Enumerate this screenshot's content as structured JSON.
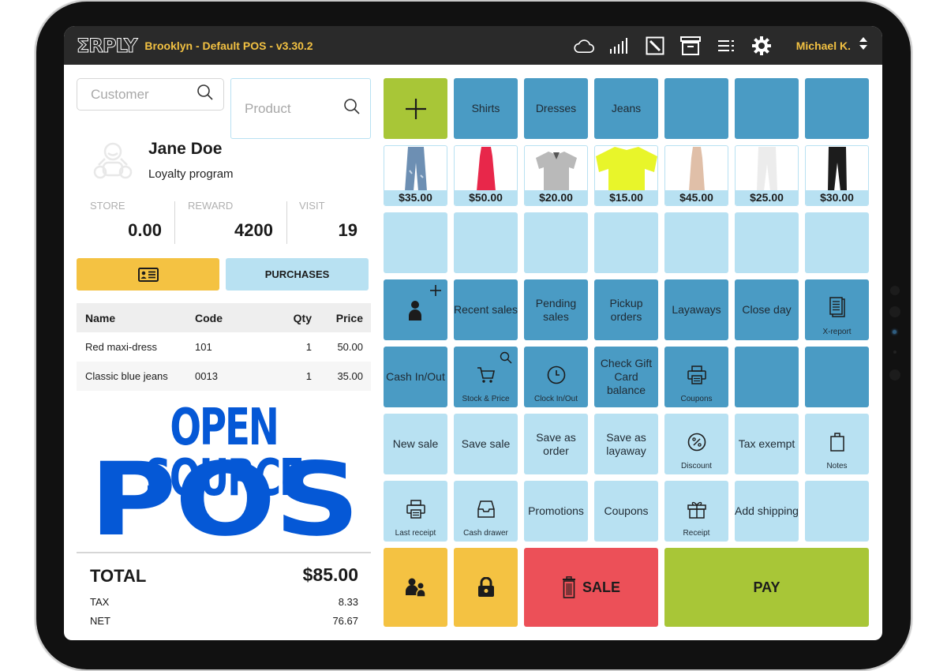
{
  "header": {
    "logo": "ΣRPLY",
    "title": "Brooklyn - Default POS - v3.30.2",
    "icons": [
      "cloud-icon",
      "signal-icon",
      "edit-icon",
      "archive-icon",
      "list-icon",
      "gear-icon"
    ],
    "user": "Michael K."
  },
  "search": {
    "customer_placeholder": "Customer",
    "product_placeholder": "Product"
  },
  "customer": {
    "name": "Jane Doe",
    "program": "Loyalty program"
  },
  "stats": [
    {
      "label": "STORE",
      "value": "0.00"
    },
    {
      "label": "REWARD",
      "value": "4200"
    },
    {
      "label": "VISIT",
      "value": "19"
    }
  ],
  "buttons": {
    "purchases": "PURCHASES"
  },
  "cart": {
    "headers": [
      "Name",
      "Code",
      "Qty",
      "Price"
    ],
    "rows": [
      {
        "name": "Red maxi-dress",
        "code": "101",
        "qty": "1",
        "price": "50.00"
      },
      {
        "name": "Classic blue jeans",
        "code": "0013",
        "qty": "1",
        "price": "35.00"
      }
    ]
  },
  "banner": {
    "line1": "OPEN SOURCE",
    "line2": "POS"
  },
  "totals": {
    "total_label": "TOTAL",
    "total_value": "$85.00",
    "tax_label": "TAX",
    "tax_value": "8.33",
    "net_label": "NET",
    "net_value": "76.67"
  },
  "categories": [
    "Shirts",
    "Dresses",
    "Jeans",
    "",
    "",
    ""
  ],
  "products": [
    {
      "name": "jeans",
      "price": "$35.00",
      "color": "#6d8fb3"
    },
    {
      "name": "red-dress",
      "price": "$50.00",
      "color": "#e8274a"
    },
    {
      "name": "grey-polo",
      "price": "$20.00",
      "color": "#b9b9b9"
    },
    {
      "name": "yellow-tshirt",
      "price": "$15.00",
      "color": "#e8f52a"
    },
    {
      "name": "beige-dress",
      "price": "$45.00",
      "color": "#e0bfa8"
    },
    {
      "name": "white-pants",
      "price": "$25.00",
      "color": "#ececec"
    },
    {
      "name": "black-pants",
      "price": "$30.00",
      "color": "#1c1c1c"
    }
  ],
  "functions_row1": {
    "recent_sales": "Recent sales",
    "pending_sales": "Pending sales",
    "pickup_orders": "Pickup orders",
    "layaways": "Layaways",
    "close_day": "Close day",
    "x_report": "X-report"
  },
  "functions_row2": {
    "cash_in_out": "Cash In/Out",
    "stock_price": "Stock & Price",
    "clock_in_out": "Clock In/Out",
    "check_gift_card": "Check Gift Card balance",
    "coupons": "Coupons"
  },
  "functions_row3": {
    "new_sale": "New sale",
    "save_sale": "Save sale",
    "save_as_order": "Save as order",
    "save_as_layaway": "Save as layaway",
    "discount": "Discount",
    "tax_exempt": "Tax exempt",
    "notes": "Notes"
  },
  "functions_row4": {
    "last_receipt": "Last receipt",
    "cash_drawer": "Cash drawer",
    "promotions": "Promotions",
    "coupons": "Coupons",
    "receipt": "Receipt",
    "add_shipping": "Add shipping"
  },
  "actions": {
    "sale": "SALE",
    "pay": "PAY"
  },
  "colors": {
    "accent_yellow": "#f4c242",
    "tile_dark": "#4a9bc4",
    "tile_light": "#b8e1f2",
    "green": "#a8c637",
    "red": "#ec5058",
    "banner_blue": "#0558d6"
  }
}
